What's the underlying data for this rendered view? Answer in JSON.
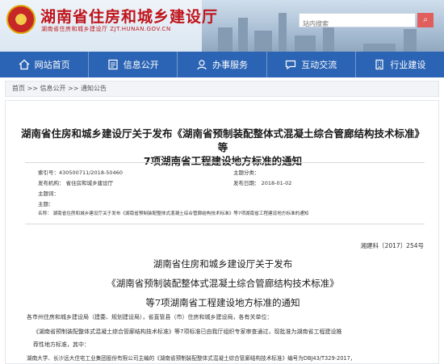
{
  "header": {
    "site_title": "湖南省住房和城乡建设厅",
    "site_subtitle": "湖南省住房和城乡建设厅 ZJT.HUNAN.GOV.CN",
    "search_placeholder": "站内搜索",
    "search_icon": "search-icon"
  },
  "nav": {
    "items": [
      {
        "label": "网站首页",
        "icon": "home-icon"
      },
      {
        "label": "信息公开",
        "icon": "info-icon"
      },
      {
        "label": "办事服务",
        "icon": "service-icon"
      },
      {
        "label": "互动交流",
        "icon": "chat-icon"
      },
      {
        "label": "行业建设",
        "icon": "building-icon"
      }
    ],
    "color": "#2b64b4"
  },
  "breadcrumb": "首页 >> 信息公开 >> 通知公告",
  "article": {
    "title_line1": "湖南省住房和城乡建设厅关于发布《湖南省预制装配整体式混凝土综合管廊结构技术标准》等",
    "title_line2": "7项湖南省工程建设地方标准的通知",
    "meta": {
      "index_no": "索引号：430500711/2018-50460",
      "topic": "主题分类：",
      "issuer": "发布机构：  省住房和城乡建设厅",
      "date": "发布日期：  2018-01-02",
      "subject_words": "主题词：",
      "subject": "主题：",
      "name": "名称：  湖南省住房和城乡建设厅关于发布《湖南省预制装配整体式混凝土综合管廊结构技术标准》等7项湖南省工程建设地方标准的通知"
    },
    "doc_number": "湘建科〔2017〕254号",
    "heading": {
      "line1": "湖南省住房和城乡建设厅关于发布",
      "line2": "《湖南省预制装配整体式混凝土综合管廊结构技术标准》",
      "line3": "等7项湖南省工程建设地方标准的通知"
    },
    "body": {
      "p1": "各市州住房和城乡建设局（建委、规划建设局），省直管县（市）住房和城乡建设局，各有关单位：",
      "p2": "《湖南省预制装配整体式混凝土综合管廊结构技术标准》等7项标准已由我厅组织专家审查通过，现批准为湖南省工程建设推",
      "p3": "荐性地方标准，其中：",
      "p4": "湖南大学、长沙远大住宅工业集团股份有限公司主编的《湖南省预制装配整体式混凝土综合管廊结构技术标准》编号为DBJ43/T329-2017，"
    }
  }
}
